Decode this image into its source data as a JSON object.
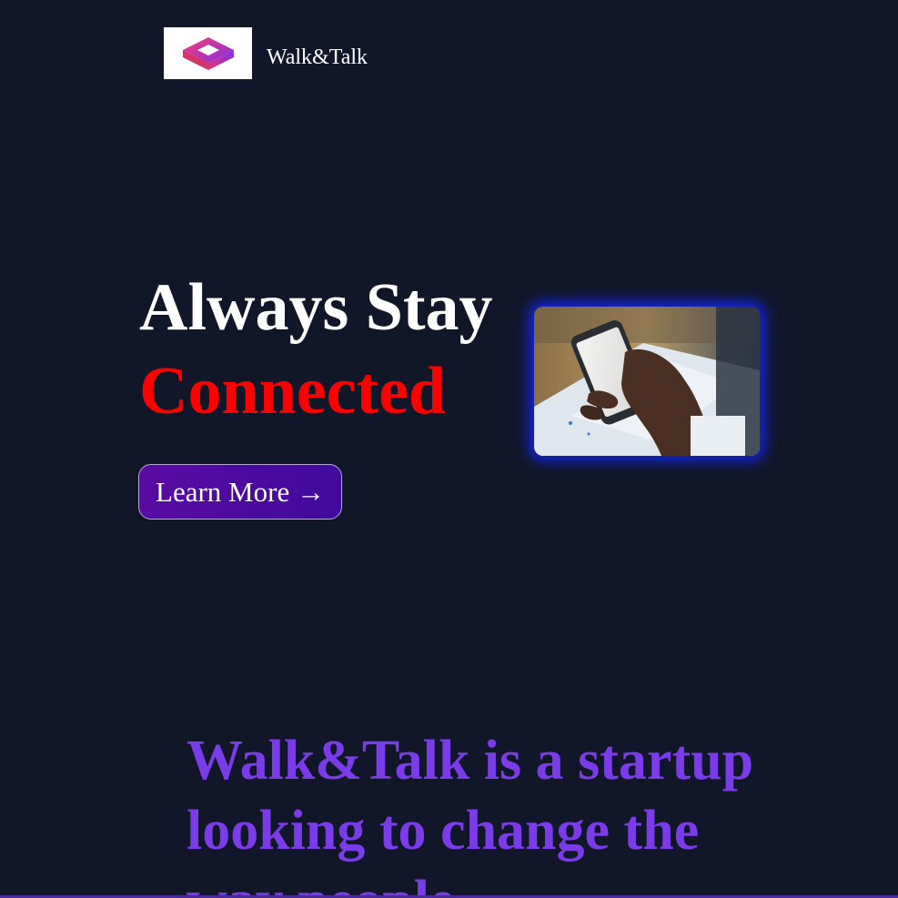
{
  "header": {
    "logo_icon": "walk-talk-logo-icon",
    "brand_name": "Walk&Talk"
  },
  "hero": {
    "title_line1": "Always Stay",
    "title_line2": "Connected",
    "cta_label": "Learn More →",
    "image_icon": "phone-in-hand-photo"
  },
  "about": {
    "text": "Walk&Talk is a startup looking to change the way people"
  },
  "colors": {
    "background": "#111729",
    "accent_red": "#ff0000",
    "accent_purple": "#7a3be8",
    "button_purple": "#5a0ba3",
    "glow_blue": "#1428ff"
  }
}
